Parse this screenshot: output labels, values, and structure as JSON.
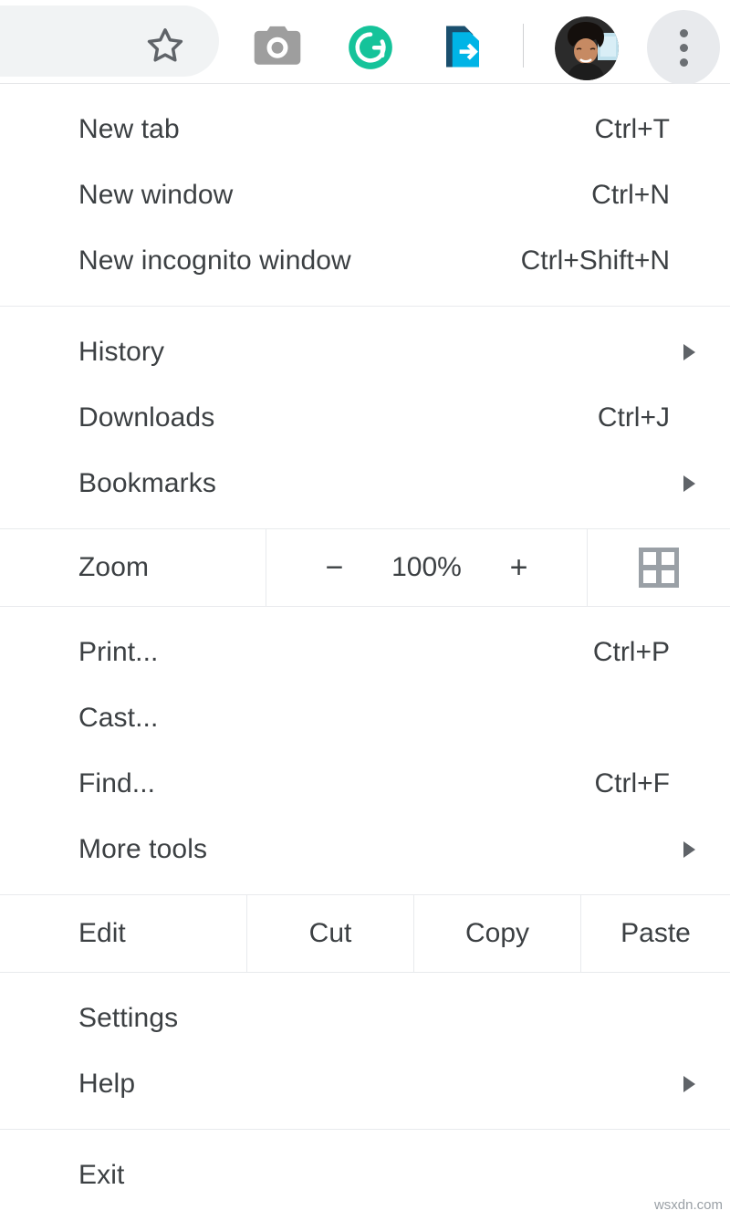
{
  "toolbar": {
    "icons": [
      {
        "name": "bookmark-star-icon",
        "label": "Bookmark this page"
      },
      {
        "name": "camera-icon",
        "label": "Screenshot extension"
      },
      {
        "name": "grammarly-icon",
        "label": "Grammarly",
        "color": "#15C39A"
      },
      {
        "name": "send-page-icon",
        "label": "Send page to device",
        "color": "#00B4E6"
      },
      {
        "name": "avatar",
        "label": "Profile"
      },
      {
        "name": "three-dot-menu-icon",
        "label": "Customize and control Google Chrome"
      }
    ]
  },
  "menu": {
    "groups": [
      {
        "id": "new",
        "items": [
          {
            "label": "New tab",
            "accel": "Ctrl+T",
            "submenu": false
          },
          {
            "label": "New window",
            "accel": "Ctrl+N",
            "submenu": false
          },
          {
            "label": "New incognito window",
            "accel": "Ctrl+Shift+N",
            "submenu": false
          }
        ]
      },
      {
        "id": "browse",
        "items": [
          {
            "label": "History",
            "accel": "",
            "submenu": true
          },
          {
            "label": "Downloads",
            "accel": "Ctrl+J",
            "submenu": false
          },
          {
            "label": "Bookmarks",
            "accel": "",
            "submenu": true
          }
        ]
      },
      {
        "id": "tools",
        "items": [
          {
            "label": "Print...",
            "accel": "Ctrl+P",
            "submenu": false
          },
          {
            "label": "Cast...",
            "accel": "",
            "submenu": false
          },
          {
            "label": "Find...",
            "accel": "Ctrl+F",
            "submenu": false
          },
          {
            "label": "More tools",
            "accel": "",
            "submenu": true
          }
        ]
      },
      {
        "id": "config",
        "items": [
          {
            "label": "Settings",
            "accel": "",
            "submenu": false
          },
          {
            "label": "Help",
            "accel": "",
            "submenu": true
          }
        ]
      },
      {
        "id": "quit",
        "items": [
          {
            "label": "Exit",
            "accel": "",
            "submenu": false
          }
        ]
      }
    ],
    "zoom_row": {
      "label": "Zoom",
      "decrease": "−",
      "value": "100%",
      "increase": "+",
      "fullscreen_icon": "fullscreen-icon"
    },
    "edit_row": {
      "label": "Edit",
      "cut": "Cut",
      "copy": "Copy",
      "paste": "Paste"
    }
  },
  "watermark": "wsxdn.com"
}
